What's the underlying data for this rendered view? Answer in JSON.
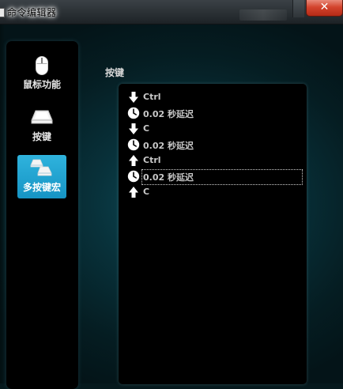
{
  "window": {
    "title": "命令编辑器",
    "close_label": "✕"
  },
  "sidebar": {
    "items": [
      {
        "label": "鼠标功能",
        "icon": "mouse-icon",
        "active": false
      },
      {
        "label": "按键",
        "icon": "key-icon",
        "active": false
      },
      {
        "label": "多按键宏",
        "icon": "multi-key-icon",
        "active": true
      }
    ]
  },
  "main": {
    "heading": "按键",
    "macro_steps": [
      {
        "icon": "arrow-down-icon",
        "text": "Ctrl"
      },
      {
        "icon": "clock-icon",
        "text": "0.02 秒延迟"
      },
      {
        "icon": "arrow-down-icon",
        "text": "C"
      },
      {
        "icon": "clock-icon",
        "text": "0.02 秒延迟"
      },
      {
        "icon": "arrow-up-icon",
        "text": "Ctrl"
      },
      {
        "icon": "clock-icon",
        "text": "0.02 秒延迟",
        "selected": true
      },
      {
        "icon": "arrow-up-icon",
        "text": "C"
      }
    ]
  },
  "colors": {
    "accent": "#1f9fcf",
    "close_red": "#d3442e",
    "panel_bg": "#000000",
    "background": "#0a3f4a"
  }
}
